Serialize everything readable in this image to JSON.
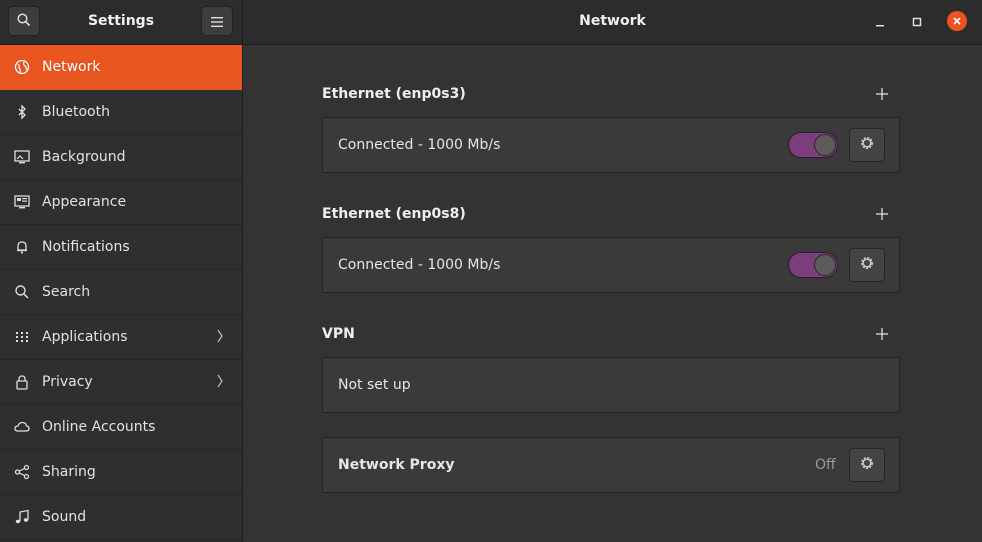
{
  "app_title": "Settings",
  "page_title": "Network",
  "sidebar": {
    "items": [
      {
        "label": "Network",
        "icon": "network-icon",
        "active": true
      },
      {
        "label": "Bluetooth",
        "icon": "bluetooth-icon"
      },
      {
        "label": "Background",
        "icon": "background-icon"
      },
      {
        "label": "Appearance",
        "icon": "appearance-icon"
      },
      {
        "label": "Notifications",
        "icon": "bell-icon"
      },
      {
        "label": "Search",
        "icon": "search-icon"
      },
      {
        "label": "Applications",
        "icon": "grid-icon",
        "has_submenu": true
      },
      {
        "label": "Privacy",
        "icon": "lock-icon",
        "has_submenu": true
      },
      {
        "label": "Online Accounts",
        "icon": "cloud-icon"
      },
      {
        "label": "Sharing",
        "icon": "share-icon"
      },
      {
        "label": "Sound",
        "icon": "music-note-icon"
      }
    ]
  },
  "main": {
    "ethernet1": {
      "title": "Ethernet (enp0s3)",
      "status": "Connected - 1000 Mb/s",
      "enabled": true
    },
    "ethernet2": {
      "title": "Ethernet (enp0s8)",
      "status": "Connected - 1000 Mb/s",
      "enabled": true
    },
    "vpn": {
      "title": "VPN",
      "status": "Not set up"
    },
    "proxy": {
      "label": "Network Proxy",
      "state": "Off"
    }
  },
  "colors": {
    "accent": "#e95420",
    "toggle_on": "#7b3d7c",
    "background": "#333333",
    "sidebar": "#2f2f2f"
  }
}
